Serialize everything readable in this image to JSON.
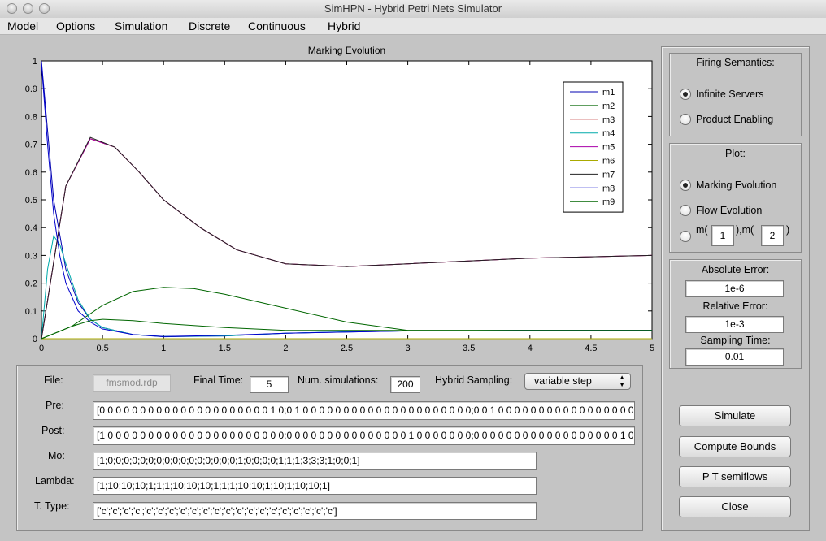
{
  "window": {
    "title": "SimHPN - Hybrid Petri Nets Simulator"
  },
  "menu": [
    "Model",
    "Options",
    "Simulation",
    "Discrete",
    "Continuous",
    "Hybrid"
  ],
  "chart_data": {
    "type": "line",
    "title": "Marking Evolution",
    "xlim": [
      0,
      5
    ],
    "ylim": [
      0,
      1
    ],
    "xticks": [
      "0",
      "0.5",
      "1",
      "1.5",
      "2",
      "2.5",
      "3",
      "3.5",
      "4",
      "4.5",
      "5"
    ],
    "yticks": [
      "0",
      "0.1",
      "0.2",
      "0.3",
      "0.4",
      "0.5",
      "0.6",
      "0.7",
      "0.8",
      "0.9",
      "1"
    ],
    "legend_position": "top-right",
    "grid": false,
    "series": [
      {
        "name": "m1",
        "color": "#0000b0",
        "x": [
          0,
          0.1,
          0.2,
          0.3,
          0.4,
          0.5,
          0.75,
          1,
          1.5,
          2,
          3,
          4,
          5
        ],
        "y": [
          1,
          0.5,
          0.25,
          0.13,
          0.07,
          0.04,
          0.015,
          0.007,
          0.01,
          0.02,
          0.028,
          0.03,
          0.03
        ]
      },
      {
        "name": "m2",
        "color": "#006600",
        "x": [
          0,
          0.25,
          0.5,
          0.75,
          1,
          1.25,
          1.5,
          2,
          2.5,
          3,
          3.5,
          4,
          5
        ],
        "y": [
          0,
          0.045,
          0.12,
          0.17,
          0.185,
          0.18,
          0.16,
          0.11,
          0.06,
          0.03,
          0.03,
          0.03,
          0.03
        ]
      },
      {
        "name": "m3",
        "color": "#b00000",
        "x": [
          0,
          0.2,
          0.4,
          0.6,
          0.8,
          1,
          1.3,
          1.6,
          2,
          2.5,
          3,
          3.5,
          4,
          4.5,
          5
        ],
        "y": [
          0,
          0.55,
          0.72,
          0.69,
          0.6,
          0.5,
          0.4,
          0.32,
          0.27,
          0.26,
          0.27,
          0.28,
          0.29,
          0.295,
          0.3
        ]
      },
      {
        "name": "m4",
        "color": "#00aaaa",
        "x": [
          0,
          0.05,
          0.1,
          0.15,
          0.2,
          0.3,
          0.4,
          0.5,
          0.75,
          1,
          1.5,
          2,
          2.5,
          3
        ],
        "y": [
          0,
          0.25,
          0.37,
          0.34,
          0.27,
          0.14,
          0.07,
          0.04,
          0.015,
          0.008,
          0.01,
          0.02,
          0.025,
          0.028
        ]
      },
      {
        "name": "m5",
        "color": "#aa00aa",
        "x": [
          0,
          0.2,
          0.4,
          0.6,
          0.8,
          1,
          1.3,
          1.6,
          2,
          2.5,
          3,
          3.5,
          4,
          4.5,
          5
        ],
        "y": [
          0,
          0.55,
          0.72,
          0.69,
          0.6,
          0.5,
          0.4,
          0.32,
          0.27,
          0.26,
          0.27,
          0.28,
          0.29,
          0.295,
          0.3
        ]
      },
      {
        "name": "m6",
        "color": "#aaaa00",
        "x": [
          0,
          0.5,
          1,
          2,
          3,
          4,
          5
        ],
        "y": [
          0,
          0,
          0,
          0,
          0,
          0,
          0
        ]
      },
      {
        "name": "m7",
        "color": "#222222",
        "x": [
          0,
          0.2,
          0.4,
          0.6,
          0.8,
          1,
          1.3,
          1.6,
          2,
          2.5,
          3,
          3.5,
          4,
          4.5,
          5
        ],
        "y": [
          0,
          0.55,
          0.725,
          0.69,
          0.6,
          0.5,
          0.4,
          0.32,
          0.27,
          0.26,
          0.27,
          0.28,
          0.29,
          0.295,
          0.3
        ]
      },
      {
        "name": "m8",
        "color": "#0000cc",
        "x": [
          0,
          0.05,
          0.1,
          0.15,
          0.2,
          0.3,
          0.4,
          0.5,
          0.75,
          1,
          1.5,
          2,
          3,
          4,
          5
        ],
        "y": [
          0.99,
          0.7,
          0.45,
          0.3,
          0.2,
          0.1,
          0.06,
          0.035,
          0.015,
          0.008,
          0.012,
          0.02,
          0.028,
          0.03,
          0.03
        ]
      },
      {
        "name": "m9",
        "color": "#006600",
        "x": [
          0,
          0.25,
          0.4,
          0.5,
          0.75,
          1,
          1.5,
          2,
          2.5,
          3,
          3.5,
          4,
          4.5,
          5
        ],
        "y": [
          0,
          0.045,
          0.065,
          0.07,
          0.065,
          0.055,
          0.04,
          0.03,
          0.03,
          0.03,
          0.03,
          0.03,
          0.03,
          0.03
        ]
      }
    ]
  },
  "params": {
    "file_label": "File:",
    "file_value": "fmsmod.rdp",
    "final_time_label": "Final Time:",
    "final_time_value": "5",
    "num_sim_label": "Num. simulations:",
    "num_sim_value": "200",
    "hybrid_sampling_label": "Hybrid Sampling:",
    "hybrid_sampling_value": "variable step",
    "pre_label": "Pre:",
    "pre_value": "[0 0 0 0 0 0 0 0 0 0 0 0 0 0 0 0 0 0 0 0 0 1 0;0 1 0 0 0 0 0 0 0 0 0 0 0 0 0 0 0 0 0 0 0 0 0;0 0 1 0 0 0 0 0 0 0 0 0 0 0 0 0 0 0 0 0 0 0 0",
    "post_label": "Post:",
    "post_value": "[1 0 0 0 0 0 0 0 0 0 0 0 0 0 0 0 0 0 0 0 0 0 0;0 0 0 0 0 0 0 0 0 0 0 0 0 0 0 1 0 0 0 0 0 0 0;0 0 0 0 0 0 0 0 0 0 0 0 0 0 0 0 0 0 1 0 0 0 0",
    "mo_label": "Mo:",
    "mo_value": "[1;0;0;0;0;0;0;0;0;0;0;0;0;0;0;0;0;1;0;0;0;0;1;1;1;3;3;3;1;0;0;1]",
    "lambda_label": "Lambda:",
    "lambda_value": "[1;10;10;10;1;1;1;10;10;10;1;1;1;10;10;1;10;1;10;10;1]",
    "ttype_label": "T. Type:",
    "ttype_value": "['c';'c';'c';'c';'c';'c';'c';'c';'c';'c';'c';'c';'c';'c';'c';'c';'c';'c';'c';'c';'c']"
  },
  "firing": {
    "title": "Firing Semantics:",
    "options": [
      "Infinite Servers",
      "Product Enabling"
    ],
    "selected": 0
  },
  "plot": {
    "title": "Plot:",
    "options": [
      "Marking Evolution",
      "Flow Evolution"
    ],
    "selected": 0,
    "m_open": "m(",
    "m_mid": "),m(",
    "m_close": ")",
    "m1_value": "1",
    "m2_value": "2"
  },
  "errors": {
    "abs_label": "Absolute Error:",
    "abs_value": "1e-6",
    "rel_label": "Relative Error:",
    "rel_value": "1e-3",
    "samp_label": "Sampling Time:",
    "samp_value": "0.01"
  },
  "buttons": {
    "simulate": "Simulate",
    "compute_bounds": "Compute Bounds",
    "pt_semiflows": "P T semiflows",
    "close": "Close"
  }
}
